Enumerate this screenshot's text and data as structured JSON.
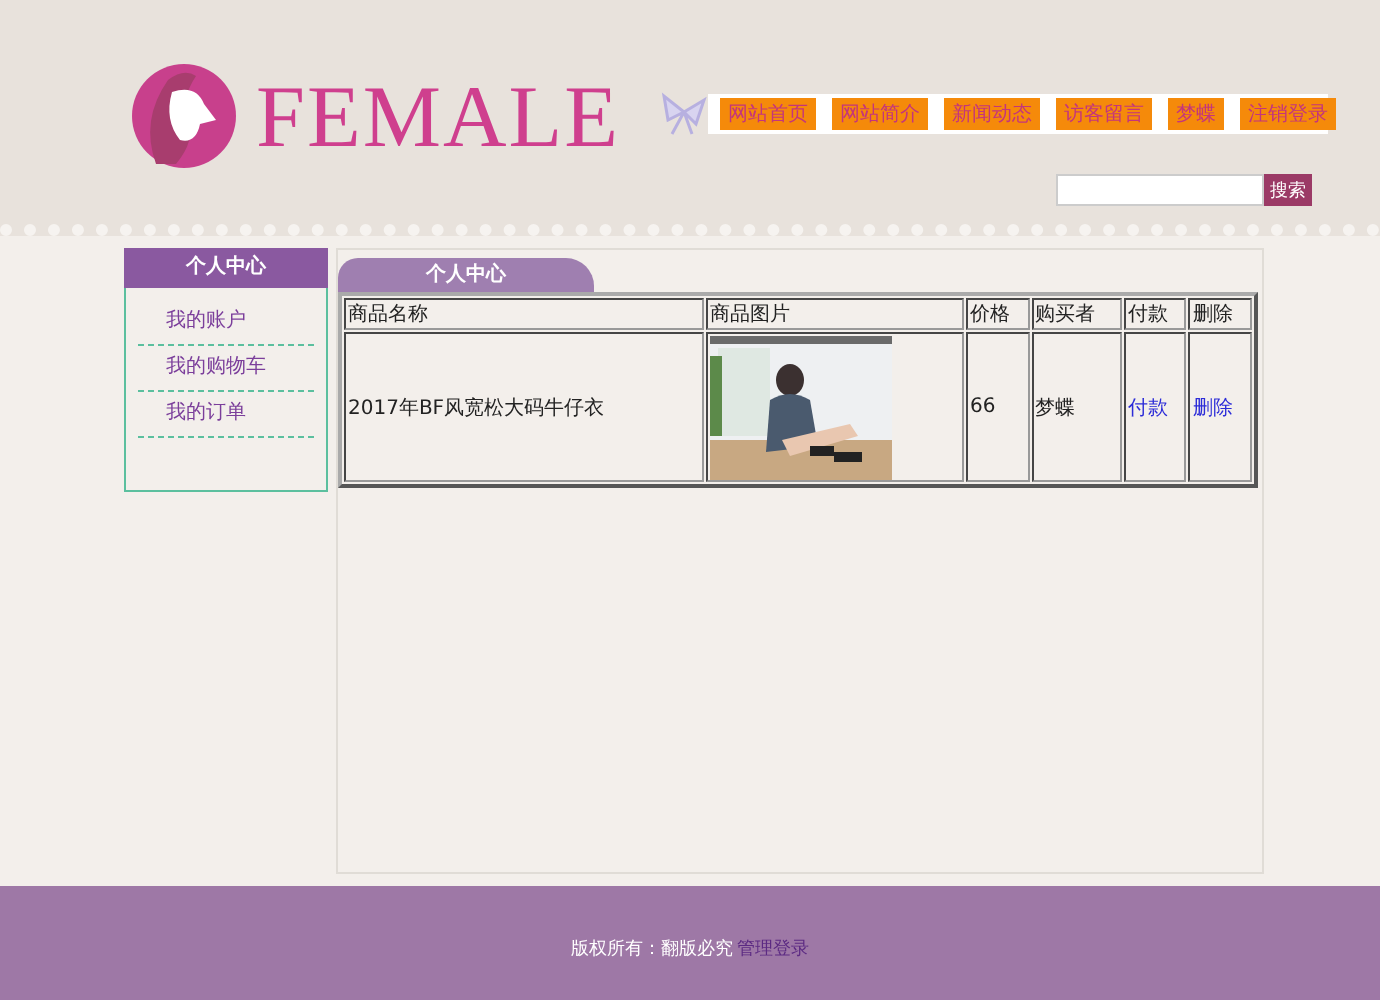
{
  "logo": {
    "title": "FEMALE"
  },
  "nav": [
    {
      "label": "网站首页"
    },
    {
      "label": "网站简介"
    },
    {
      "label": "新闻动态"
    },
    {
      "label": "访客留言"
    },
    {
      "label": "梦蝶"
    },
    {
      "label": "注销登录"
    }
  ],
  "search": {
    "button": "搜索"
  },
  "sidebar": {
    "title": "个人中心",
    "items": [
      {
        "label": "我的账户"
      },
      {
        "label": "我的购物车"
      },
      {
        "label": "我的订单"
      }
    ]
  },
  "panel": {
    "tab": "个人中心"
  },
  "table": {
    "columns": [
      "商品名称",
      "商品图片",
      "价格",
      "购买者",
      "付款",
      "删除"
    ],
    "rows": [
      {
        "cells": [
          {
            "kind": "text",
            "text": "2017年BF风宽松大码牛仔衣"
          },
          {
            "kind": "picture"
          },
          {
            "kind": "text",
            "text": "66"
          },
          {
            "kind": "text",
            "text": "梦蝶"
          },
          {
            "kind": "link",
            "text": "付款"
          },
          {
            "kind": "link",
            "text": "删除"
          }
        ]
      }
    ]
  },
  "footer": {
    "text": "版权所有：翻版必究",
    "link": "管理登录"
  }
}
